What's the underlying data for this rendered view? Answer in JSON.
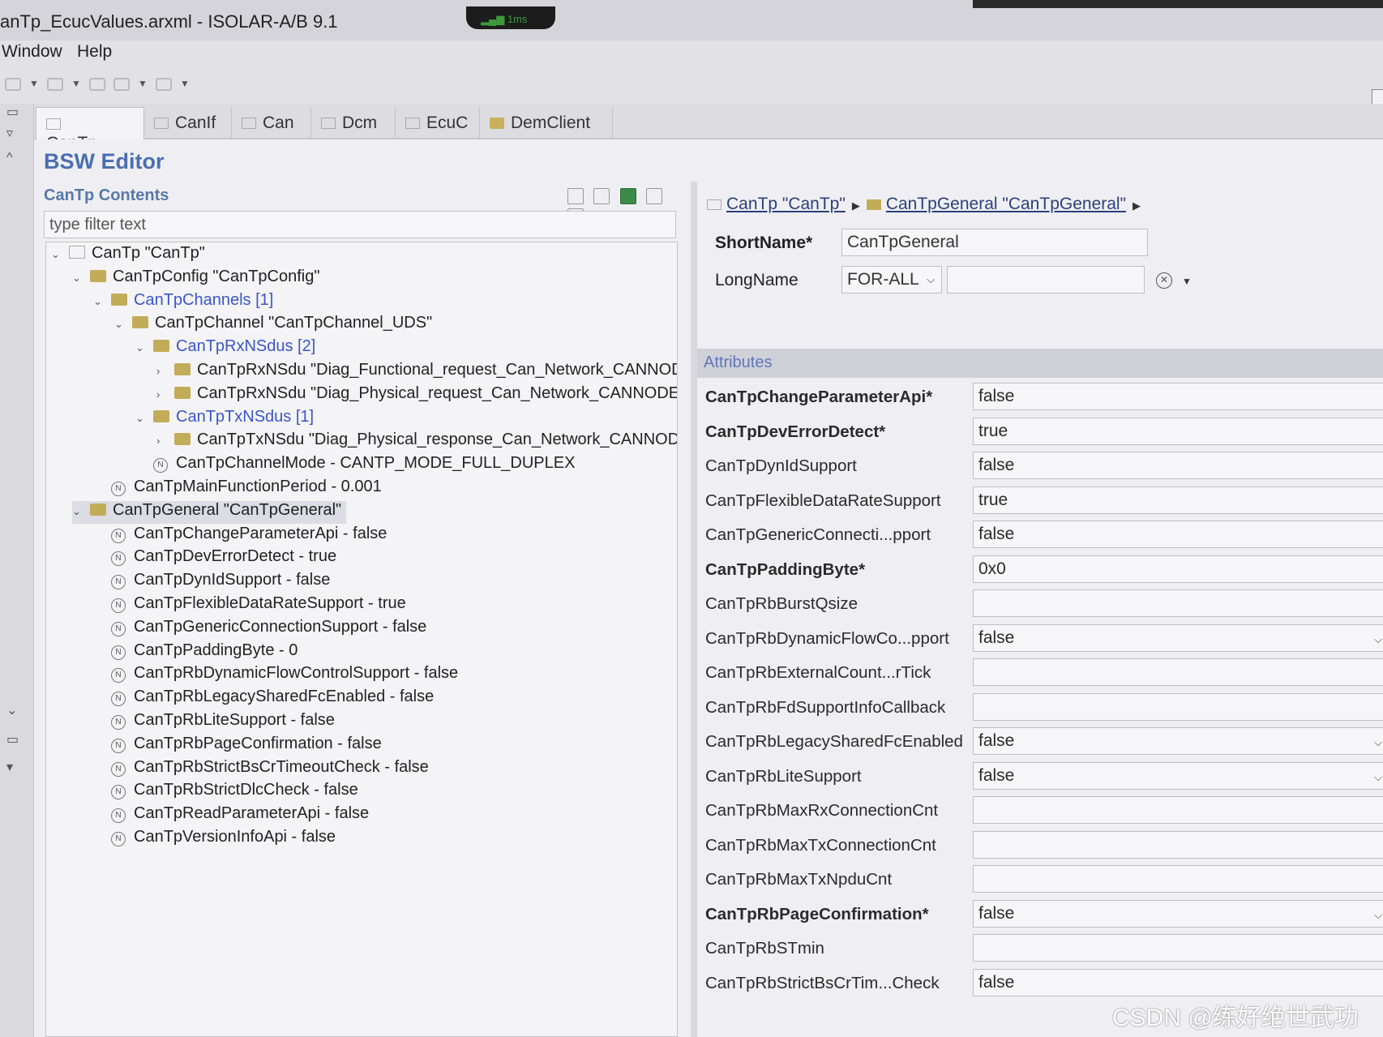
{
  "window": {
    "title": "anTp_EcucValues.arxml - ISOLAR-A/B 9.1",
    "signal": "1ms"
  },
  "menu": [
    "Window",
    "Help"
  ],
  "tabs": [
    {
      "label": "CanTp",
      "icon": "module-icon",
      "active": true
    },
    {
      "label": "CanIf",
      "icon": "module-icon"
    },
    {
      "label": "Can",
      "icon": "module-icon"
    },
    {
      "label": "Dcm",
      "icon": "module-icon"
    },
    {
      "label": "EcuC",
      "icon": "module-icon"
    },
    {
      "label": "DemClient",
      "icon": "folder-icon"
    }
  ],
  "editor": {
    "title": "BSW Editor",
    "contents_title": "CanTp Contents",
    "filter_placeholder": "type filter text"
  },
  "tree": [
    {
      "text": "CanTp \"CanTp\"",
      "icon": "module",
      "twisty": "v"
    },
    {
      "text": "CanTpConfig \"CanTpConfig\"",
      "icon": "folder",
      "twisty": "v"
    },
    {
      "text": "CanTpChannels [1]",
      "icon": "folder",
      "twisty": "v",
      "link": true
    },
    {
      "text": "CanTpChannel \"CanTpChannel_UDS\"",
      "icon": "folder",
      "twisty": "v"
    },
    {
      "text": "CanTpRxNSdus [2]",
      "icon": "folder",
      "twisty": "v",
      "link": true
    },
    {
      "text": "CanTpRxNSdu \"Diag_Functional_request_Can_Network_CANNOD",
      "icon": "folder",
      "twisty": ">"
    },
    {
      "text": "CanTpRxNSdu \"Diag_Physical_request_Can_Network_CANNODE_(",
      "icon": "folder",
      "twisty": ">"
    },
    {
      "text": "CanTpTxNSdus [1]",
      "icon": "folder",
      "twisty": "v",
      "link": true
    },
    {
      "text": "CanTpTxNSdu \"Diag_Physical_response_Can_Network_CANNODE",
      "icon": "folder",
      "twisty": ">"
    },
    {
      "text": "CanTpChannelMode - CANTP_MODE_FULL_DUPLEX",
      "icon": "param",
      "twisty": ""
    },
    {
      "text": "CanTpMainFunctionPeriod - 0.001",
      "icon": "param",
      "twisty": ""
    },
    {
      "text": "CanTpGeneral \"CanTpGeneral\"",
      "icon": "folder",
      "twisty": "v",
      "selected": true
    },
    {
      "text": "CanTpChangeParameterApi - false",
      "icon": "param",
      "twisty": ""
    },
    {
      "text": "CanTpDevErrorDetect - true",
      "icon": "param",
      "twisty": ""
    },
    {
      "text": "CanTpDynIdSupport - false",
      "icon": "param",
      "twisty": ""
    },
    {
      "text": "CanTpFlexibleDataRateSupport - true",
      "icon": "param",
      "twisty": ""
    },
    {
      "text": "CanTpGenericConnectionSupport - false",
      "icon": "param",
      "twisty": ""
    },
    {
      "text": "CanTpPaddingByte - 0",
      "icon": "param",
      "twisty": ""
    },
    {
      "text": "CanTpRbDynamicFlowControlSupport - false",
      "icon": "param",
      "twisty": ""
    },
    {
      "text": "CanTpRbLegacySharedFcEnabled - false",
      "icon": "param",
      "twisty": ""
    },
    {
      "text": "CanTpRbLiteSupport - false",
      "icon": "param",
      "twisty": ""
    },
    {
      "text": "CanTpRbPageConfirmation - false",
      "icon": "param",
      "twisty": ""
    },
    {
      "text": "CanTpRbStrictBsCrTimeoutCheck - false",
      "icon": "param",
      "twisty": ""
    },
    {
      "text": "CanTpRbStrictDlcCheck - false",
      "icon": "param",
      "twisty": ""
    },
    {
      "text": "CanTpReadParameterApi - false",
      "icon": "param",
      "twisty": ""
    },
    {
      "text": "CanTpVersionInfoApi - false",
      "icon": "param",
      "twisty": ""
    }
  ],
  "breadcrumb": {
    "first": "CanTp \"CanTp\"",
    "second": "CanTpGeneral \"CanTpGeneral\""
  },
  "form": {
    "shortname_label": "ShortName*",
    "shortname_value": "CanTpGeneral",
    "longname_label": "LongName",
    "longname_lang": "FOR-ALL",
    "attributes_label": "Attributes"
  },
  "attributes": [
    {
      "name": "CanTpChangeParameterApi*",
      "value": "false",
      "bold": true
    },
    {
      "name": "CanTpDevErrorDetect*",
      "value": "true",
      "bold": true
    },
    {
      "name": "CanTpDynIdSupport",
      "value": "false"
    },
    {
      "name": "CanTpFlexibleDataRateSupport",
      "value": "true"
    },
    {
      "name": "CanTpGenericConnecti...pport",
      "value": "false"
    },
    {
      "name": "CanTpPaddingByte*",
      "value": "0x0",
      "bold": true
    },
    {
      "name": "CanTpRbBurstQsize",
      "value": ""
    },
    {
      "name": "CanTpRbDynamicFlowCo...pport",
      "value": "false",
      "dropdown": true
    },
    {
      "name": "CanTpRbExternalCount...rTick",
      "value": ""
    },
    {
      "name": "CanTpRbFdSupportInfoCallback",
      "value": ""
    },
    {
      "name": "CanTpRbLegacySharedFcEnabled",
      "value": "false",
      "dropdown": true
    },
    {
      "name": "CanTpRbLiteSupport",
      "value": "false",
      "dropdown": true
    },
    {
      "name": "CanTpRbMaxRxConnectionCnt",
      "value": ""
    },
    {
      "name": "CanTpRbMaxTxConnectionCnt",
      "value": ""
    },
    {
      "name": "CanTpRbMaxTxNpduCnt",
      "value": ""
    },
    {
      "name": "CanTpRbPageConfirmation*",
      "value": "false",
      "bold": true,
      "dropdown": true
    },
    {
      "name": "CanTpRbSTmin",
      "value": ""
    },
    {
      "name": "CanTpRbStrictBsCrTim...Check",
      "value": "false"
    }
  ],
  "watermark": "CSDN @练好绝世武功"
}
